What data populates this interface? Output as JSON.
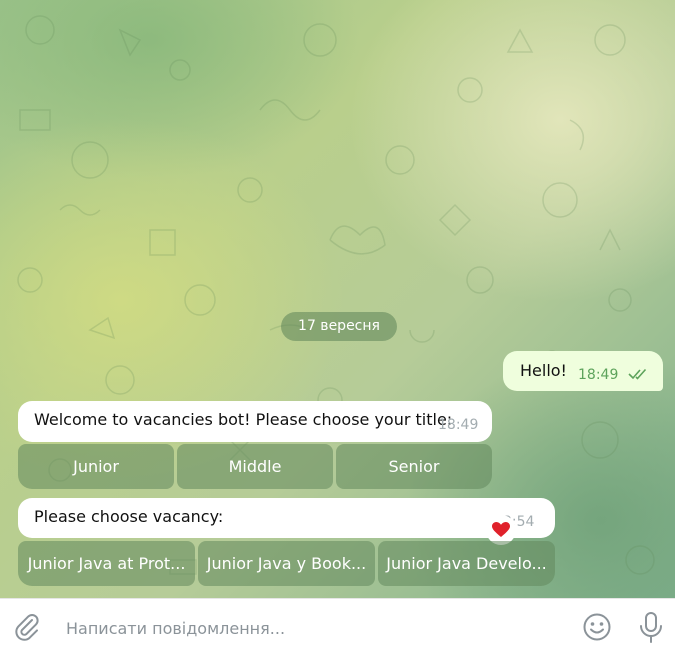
{
  "chat": {
    "date_label": "17 вересня",
    "outgoing": {
      "text": "Hello!",
      "time": "18:49",
      "status_icon": "double-check-icon"
    },
    "messages": [
      {
        "text": "Welcome to vacancies bot! Please choose your title:",
        "time": "18:49",
        "buttons": [
          "Junior",
          "Middle",
          "Senior"
        ]
      },
      {
        "text": "Please choose vacancy:",
        "time": "3:54",
        "reaction_icon": "heart-icon",
        "buttons": [
          "Junior Java at Prot...",
          "Junior Java у Book...",
          "Junior Java Develo..."
        ]
      }
    ]
  },
  "composer": {
    "placeholder": "Написати повідомлення...",
    "icons": [
      "paperclip-icon",
      "smile-icon",
      "microphone-icon"
    ]
  },
  "colors": {
    "outgoing_bubble": "#effedd",
    "check": "#5da35b",
    "keyboard_button": "#62885c"
  }
}
